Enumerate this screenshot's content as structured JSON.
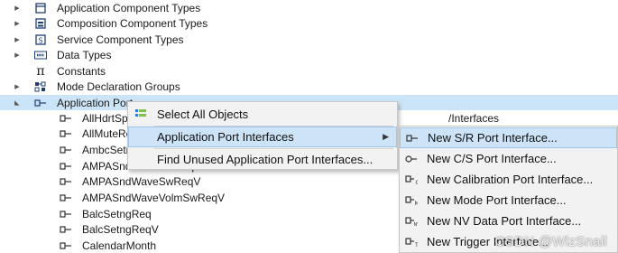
{
  "tree": {
    "root_items": [
      {
        "label": "Application Component Types",
        "icon": "component-type-icon"
      },
      {
        "label": "Composition Component Types",
        "icon": "composition-type-icon"
      },
      {
        "label": "Service Component Types",
        "icon": "service-type-icon"
      },
      {
        "label": "Data Types",
        "icon": "data-types-icon"
      },
      {
        "label": "Constants",
        "icon": "pi-icon"
      },
      {
        "label": "Mode Declaration Groups",
        "icon": "mode-groups-icon"
      },
      {
        "label": "Application Port Interfaces",
        "icon": "port-interface-icon"
      }
    ],
    "selected_visible_label": "Application Port",
    "children": [
      "AllHdrtSpk",
      "AllMuteRe",
      "AmbcSetn",
      "AMPASndWaveSelReqV",
      "AMPASndWaveSwReqV",
      "AMPASndWaveVolmSwReqV",
      "BalcSetngReq",
      "BalcSetngReqV",
      "CalendarMonth"
    ],
    "path_text": "/Interfaces"
  },
  "context_menu": {
    "items": [
      {
        "label": "Select All Objects",
        "icon": "select-all-icon"
      },
      {
        "label": "Application Port Interfaces",
        "icon": "none",
        "has_submenu": true
      },
      {
        "label": "Find Unused Application Port Interfaces...",
        "icon": "none"
      }
    ]
  },
  "submenu": {
    "items": [
      {
        "label": "New S/R Port Interface...",
        "icon": "sr-port-icon"
      },
      {
        "label": "New C/S Port Interface...",
        "icon": "cs-port-icon"
      },
      {
        "label": "New Calibration Port Interface...",
        "icon": "calibration-port-icon"
      },
      {
        "label": "New Mode Port Interface...",
        "icon": "mode-port-icon"
      },
      {
        "label": "New NV Data Port Interface...",
        "icon": "nv-port-icon"
      },
      {
        "label": "New Trigger Interface...",
        "icon": "trigger-port-icon"
      }
    ]
  },
  "watermark": "CSDN @WlzSnail",
  "colors": {
    "selection": "#cce4f7",
    "menu_bg": "#f2f2f2",
    "menu_highlight": "#cde3f7",
    "icon_blue": "#1f3f73"
  }
}
